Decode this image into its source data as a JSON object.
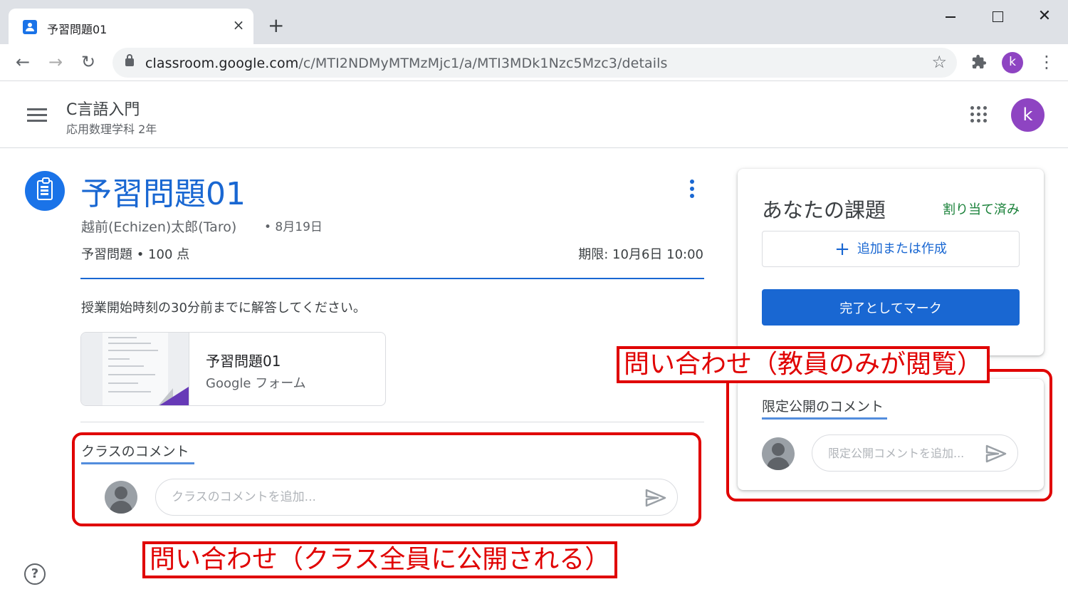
{
  "browser": {
    "tab_title": "予習問題01",
    "tab_close": "×",
    "new_tab": "+",
    "window_close": "✕",
    "back": "←",
    "forward": "→",
    "reload": "↻",
    "url_host": "classroom.google.com",
    "url_path": "/c/MTI2NDMyMTMzMjc1/a/MTI3MDk1Nzc5Mzc3/details",
    "bookmark_star": "☆",
    "extensions_icon": "puzzle-icon",
    "profile_initial": "k",
    "menu": "⋮",
    "profile_color": "#8e44c2"
  },
  "header": {
    "class_name": "C言語入門",
    "section": "応用数理学科 2年",
    "avatar_initial": "k"
  },
  "assignment": {
    "title": "予習問題01",
    "author": "越前(Echizen)太郎(Taro)",
    "posted": "• 8月19日",
    "points": "予習問題 • 100 点",
    "due": "期限: 10月6日 10:00",
    "instructions": "授業開始時刻の30分前までに解答してください。",
    "attachment": {
      "title": "予習問題01",
      "type": "Google フォーム"
    }
  },
  "class_comments": {
    "label": "クラスのコメント",
    "placeholder": "クラスのコメントを追加..."
  },
  "your_work": {
    "title": "あなたの課題",
    "status": "割り当て済み",
    "add_button": "追加または作成",
    "add_plus": "+",
    "mark_done_button": "完了としてマーク"
  },
  "private_comments": {
    "label": "限定公開のコメント",
    "placeholder": "限定公開コメントを追加..."
  },
  "help": "?",
  "annotations": {
    "private_note": "問い合わせ（教員のみが閲覧）",
    "class_note": "問い合わせ（クラス全員に公開される）"
  },
  "colors": {
    "accent": "#1967d2",
    "annotation_red": "#e00000",
    "status_green": "#188038"
  }
}
